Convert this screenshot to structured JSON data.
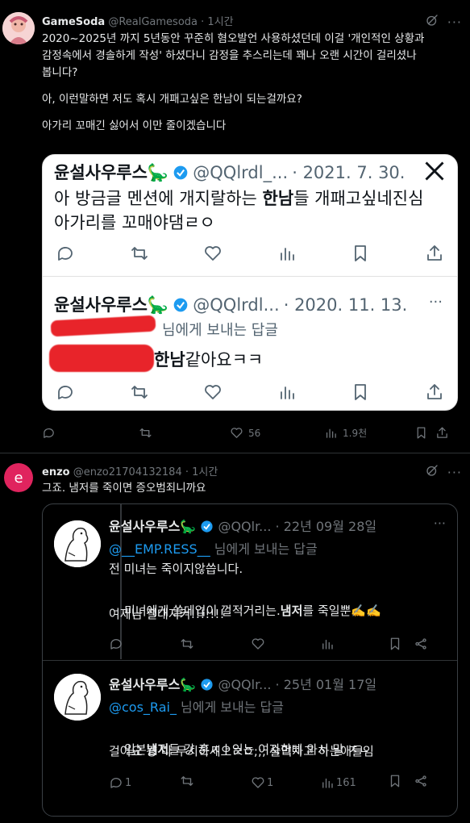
{
  "post1": {
    "display_name": "GameSoda",
    "handle": "@RealGamesoda",
    "dot": "·",
    "time": "1시간",
    "text_lines": [
      "2020~2025년 까지 5년동안 꾸준히 혐오발언 사용하셨던데 이걸 '개인적인 상황과",
      "감정속에서 경솔하게 작성' 하셨다니 감정을 추스리는데 꽤나 오랜 시간이 걸리셨나",
      "봅니다?",
      "",
      "아, 이런말하면 저도 혹시 개패고싶은 한남이 되는걸까요?",
      "",
      "아가리 꼬매긴 싫어서 이만 줄이겠습니다"
    ],
    "embed": {
      "tweet1": {
        "name": "윤설사우루스🦕",
        "handle": "@QQlrdl_...",
        "date": "· 2021. 7. 30.",
        "line1_pre": "아 방금글 멘션에 개지랄하는 ",
        "line1_bold": "한남",
        "line1_post": "들 개패고싶네진심",
        "line2": "아가리를 꼬매야댐ㄹㅇ"
      },
      "tweet2": {
        "name": "윤설사우루스🦕",
        "handle": "@QQlrdl...",
        "date": "· 2020. 11. 13.",
        "more": "···",
        "reply_to": "님에게 보내는 답글",
        "line_bold": "한남",
        "line_post": "같아요ㅋㅋ"
      }
    },
    "stats": {
      "replies": "",
      "retweets": "",
      "likes": "56",
      "views": "1.9천"
    }
  },
  "post2": {
    "avatar_letter": "e",
    "display_name": "enzo",
    "handle": "@enzo21704132184",
    "dot": "·",
    "time": "1시간",
    "text": "그죠. 냄저를 죽이면 증오범죄니까요",
    "quote": {
      "tweet1": {
        "name": "윤설사우루스🦕",
        "handle": "@QQlr...",
        "date": "· 22년 09월 28일",
        "mention": "@__EMP.RESS__",
        "reply_to": " 님에게 보내는 답글",
        "line1": "전 미녀는 죽이지않씁니다.",
        "line2_pre": "미녀에게 쓸데업이 껄적거리는.",
        "line2_bold": "냄저",
        "line2_post": "를 죽일뿐✍️✍️",
        "line3": "여제님 절대지켜!!!!!!!"
      },
      "tweet2": {
        "name": "윤설사우루스🦕",
        "handle": "@QQlr...",
        "date": "· 25년 01월 17일",
        "mention": "@cos_Rai_",
        "reply_to": " 님에게 보내는 답글",
        "line1_pre": "일본",
        "line1_bold": "냄저",
        "line1_post": "들 걍 혼ㅈㅏ잇는 여자한테 와서 말 ㅈㄴ",
        "line2": "걸어요 걍 다 무시하세오ㄹㅇ;;; 술먹자고 하는애들임",
        "replies": "1",
        "likes": "1",
        "views": "161"
      }
    }
  },
  "icons": [
    "reply-icon",
    "retweet-icon",
    "like-icon",
    "views-icon",
    "bookmark-icon",
    "share-icon",
    "grok-icon",
    "more-icon",
    "x-logo-icon",
    "verified-icon"
  ]
}
